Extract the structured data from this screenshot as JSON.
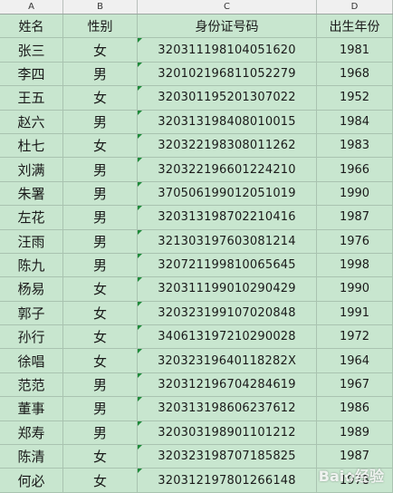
{
  "columns": [
    "A",
    "B",
    "C",
    "D"
  ],
  "headers": {
    "name": "姓名",
    "sex": "性别",
    "id": "身份证号码",
    "year": "出生年份"
  },
  "rows": [
    {
      "name": "张三",
      "sex": "女",
      "id": "320311198104051620",
      "year": "1981"
    },
    {
      "name": "李四",
      "sex": "男",
      "id": "320102196811052279",
      "year": "1968"
    },
    {
      "name": "王五",
      "sex": "女",
      "id": "320301195201307022",
      "year": "1952"
    },
    {
      "name": "赵六",
      "sex": "男",
      "id": "320313198408010015",
      "year": "1984"
    },
    {
      "name": "杜七",
      "sex": "女",
      "id": "320322198308011262",
      "year": "1983"
    },
    {
      "name": "刘满",
      "sex": "男",
      "id": "320322196601224210",
      "year": "1966"
    },
    {
      "name": "朱署",
      "sex": "男",
      "id": "370506199012051019",
      "year": "1990"
    },
    {
      "name": "左花",
      "sex": "男",
      "id": "320313198702210416",
      "year": "1987"
    },
    {
      "name": "汪雨",
      "sex": "男",
      "id": "321303197603081214",
      "year": "1976"
    },
    {
      "name": "陈九",
      "sex": "男",
      "id": "320721199810065645",
      "year": "1998"
    },
    {
      "name": "杨易",
      "sex": "女",
      "id": "320311199010290429",
      "year": "1990"
    },
    {
      "name": "郭子",
      "sex": "女",
      "id": "320323199107020848",
      "year": "1991"
    },
    {
      "name": "孙行",
      "sex": "女",
      "id": "340613197210290028",
      "year": "1972"
    },
    {
      "name": "徐唱",
      "sex": "女",
      "id": "32032319640118282X",
      "year": "1964"
    },
    {
      "name": "范范",
      "sex": "男",
      "id": "320312196704284619",
      "year": "1967"
    },
    {
      "name": "董事",
      "sex": "男",
      "id": "320313198606237612",
      "year": "1986"
    },
    {
      "name": "郑寿",
      "sex": "男",
      "id": "320303198901101212",
      "year": "1989"
    },
    {
      "name": "陈清",
      "sex": "女",
      "id": "320323198707185825",
      "year": "1987"
    },
    {
      "name": "何必",
      "sex": "女",
      "id": "320312197801266148",
      "year": "1978"
    }
  ],
  "watermark": {
    "text": "Bai",
    "suffix": "经验",
    "icon": "baidu-paw-icon"
  },
  "colors": {
    "sheet_bg": "#c8e6cf",
    "grid": "#a9c3b0",
    "triangle": "#1e8a3a"
  }
}
